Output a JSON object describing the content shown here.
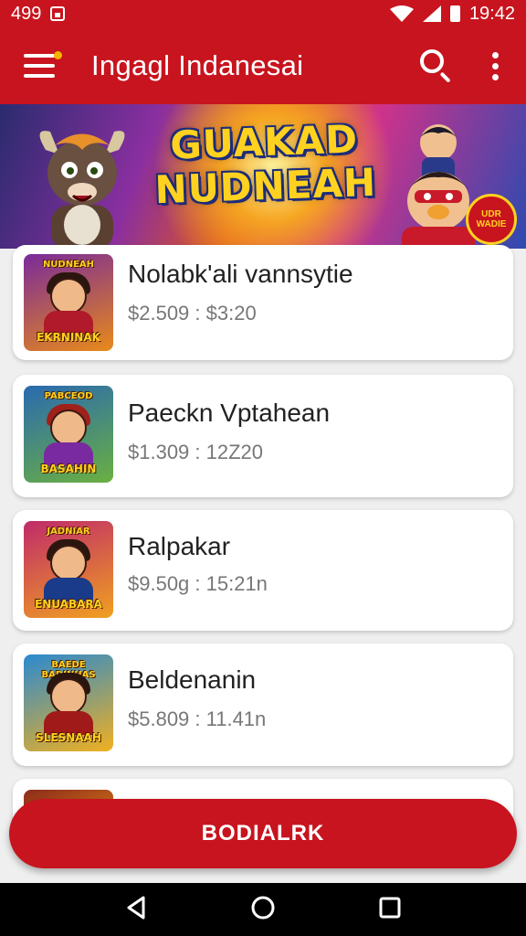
{
  "status_bar": {
    "time": "499",
    "clock": "19:42"
  },
  "app_bar": {
    "title": "Ingagl Indanesai",
    "icons": [
      "menu-icon",
      "search-icon",
      "more-vert-icon"
    ]
  },
  "banner": {
    "title_line1": "GUAKAD",
    "title_line2": "NUDNEAH",
    "badge": "UDR WADIE"
  },
  "items": [
    {
      "title": "Nolabk'ali vannsytie",
      "price": "$2.509 : $3:20",
      "thumb_top": "NUDNEAH",
      "thumb_bottom": "EKRNINAK",
      "thumb_colors": [
        "#7a2a9a",
        "#e88a1a"
      ]
    },
    {
      "title": "Paeckn Vptahean",
      "price": "$1.309 : 12Z20",
      "thumb_top": "PABCEOD",
      "thumb_bottom": "BASAHIN",
      "thumb_colors": [
        "#2a6ab0",
        "#6ab040"
      ]
    },
    {
      "title": "Ralpakar",
      "price": "$9.50g : 15:21n",
      "thumb_top": "JADNIAR",
      "thumb_bottom": "ENUABARA",
      "thumb_colors": [
        "#c02a6a",
        "#f0a020"
      ]
    },
    {
      "title": "Beldenanin",
      "price": "$5.809 : 11.41n",
      "thumb_top": "BAEDE BADINHAS",
      "thumb_bottom": "SLESNAAH",
      "thumb_colors": [
        "#2a8ad0",
        "#f0b020"
      ]
    }
  ],
  "cta": {
    "label": "BODIALRK"
  },
  "colors": {
    "primary": "#c8141e",
    "badge": "#f6b400"
  }
}
